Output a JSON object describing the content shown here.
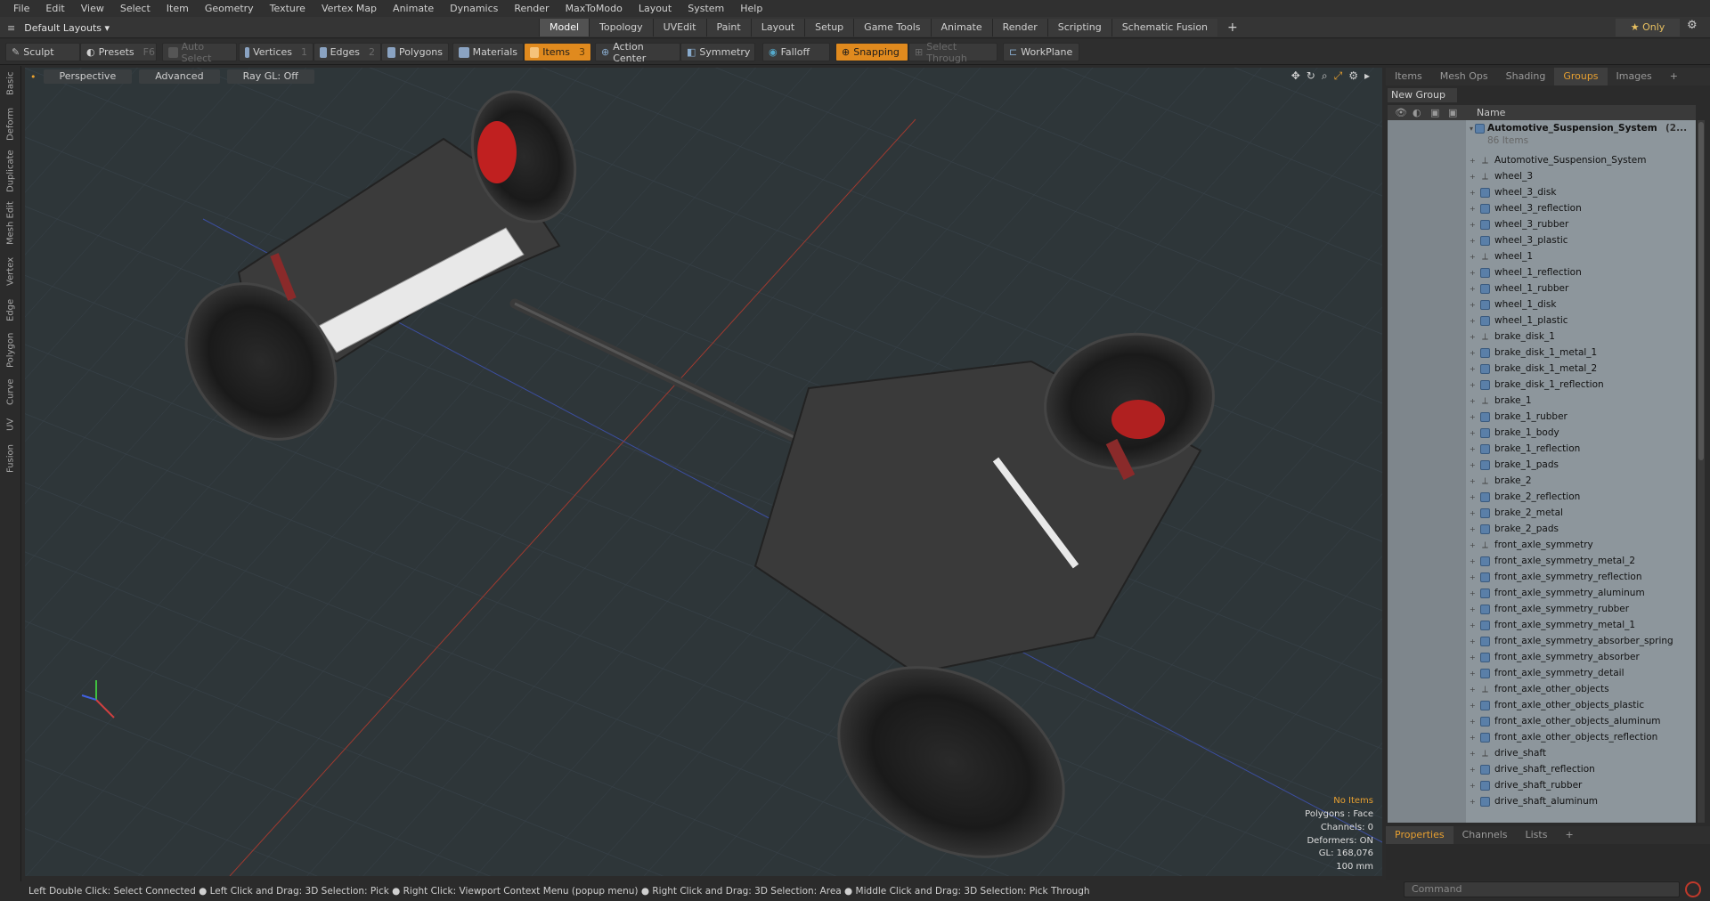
{
  "menubar": {
    "items": [
      "File",
      "Edit",
      "View",
      "Select",
      "Item",
      "Geometry",
      "Texture",
      "Vertex Map",
      "Animate",
      "Dynamics",
      "Render",
      "MaxToModo",
      "Layout",
      "System",
      "Help"
    ]
  },
  "layoutbar": {
    "layout_dropdown": "Default Layouts ▾",
    "tabs": [
      "Model",
      "Topology",
      "UVEdit",
      "Paint",
      "Layout",
      "Setup",
      "Game Tools",
      "Animate",
      "Render",
      "Scripting",
      "Schematic Fusion"
    ],
    "active_tab": "Model",
    "plus": "+",
    "only_button": "★ Only"
  },
  "toolbar": {
    "sculpt": "Sculpt",
    "presets": "Presets",
    "presets_key": "F6",
    "auto_select": "Auto Select",
    "vertices": "Vertices",
    "vertices_count": "1",
    "edges": "Edges",
    "edges_count": "2",
    "polygons": "Polygons",
    "materials": "Materials",
    "items": "Items",
    "items_count": "3",
    "action_center": "Action Center",
    "symmetry": "Symmetry",
    "falloff": "Falloff",
    "snapping": "Snapping",
    "select_through": "Select Through",
    "workplane": "WorkPlane"
  },
  "left_tabs": [
    "Basic",
    "Deform",
    "Duplicate",
    "Mesh Edit",
    "Vertex",
    "Edge",
    "Polygon",
    "Curve",
    "UV",
    "Fusion"
  ],
  "viewport": {
    "view_mode": "Perspective",
    "shading": "Advanced",
    "raygl": "Ray GL: Off",
    "info": {
      "selection": "No Items",
      "polygons": "Polygons : Face",
      "channels": "Channels: 0",
      "deformers": "Deformers: ON",
      "gl": "GL: 168,076",
      "scale": "100 mm"
    }
  },
  "right_panel": {
    "tabs": [
      "Items",
      "Mesh Ops",
      "Shading",
      "Groups",
      "Images"
    ],
    "active_tab": "Groups",
    "plus": "+",
    "new_group": "New Group",
    "column_name": "Name",
    "root": {
      "name": "Automotive_Suspension_System",
      "suffix": "(2...",
      "count": "86 Items"
    },
    "items": [
      {
        "name": "Automotive_Suspension_System",
        "kind": "locator"
      },
      {
        "name": "wheel_3",
        "kind": "locator"
      },
      {
        "name": "wheel_3_disk",
        "kind": "mesh"
      },
      {
        "name": "wheel_3_reflection",
        "kind": "mesh"
      },
      {
        "name": "wheel_3_rubber",
        "kind": "mesh"
      },
      {
        "name": "wheel_3_plastic",
        "kind": "mesh"
      },
      {
        "name": "wheel_1",
        "kind": "locator"
      },
      {
        "name": "wheel_1_reflection",
        "kind": "mesh"
      },
      {
        "name": "wheel_1_rubber",
        "kind": "mesh"
      },
      {
        "name": "wheel_1_disk",
        "kind": "mesh"
      },
      {
        "name": "wheel_1_plastic",
        "kind": "mesh"
      },
      {
        "name": "brake_disk_1",
        "kind": "locator"
      },
      {
        "name": "brake_disk_1_metal_1",
        "kind": "mesh"
      },
      {
        "name": "brake_disk_1_metal_2",
        "kind": "mesh"
      },
      {
        "name": "brake_disk_1_reflection",
        "kind": "mesh"
      },
      {
        "name": "brake_1",
        "kind": "locator"
      },
      {
        "name": "brake_1_rubber",
        "kind": "mesh"
      },
      {
        "name": "brake_1_body",
        "kind": "mesh"
      },
      {
        "name": "brake_1_reflection",
        "kind": "mesh"
      },
      {
        "name": "brake_1_pads",
        "kind": "mesh"
      },
      {
        "name": "brake_2",
        "kind": "locator"
      },
      {
        "name": "brake_2_reflection",
        "kind": "mesh"
      },
      {
        "name": "brake_2_metal",
        "kind": "mesh"
      },
      {
        "name": "brake_2_pads",
        "kind": "mesh"
      },
      {
        "name": "front_axle_symmetry",
        "kind": "locator"
      },
      {
        "name": "front_axle_symmetry_metal_2",
        "kind": "mesh"
      },
      {
        "name": "front_axle_symmetry_reflection",
        "kind": "mesh"
      },
      {
        "name": "front_axle_symmetry_aluminum",
        "kind": "mesh"
      },
      {
        "name": "front_axle_symmetry_rubber",
        "kind": "mesh"
      },
      {
        "name": "front_axle_symmetry_metal_1",
        "kind": "mesh"
      },
      {
        "name": "front_axle_symmetry_absorber_spring",
        "kind": "mesh"
      },
      {
        "name": "front_axle_symmetry_absorber",
        "kind": "mesh"
      },
      {
        "name": "front_axle_symmetry_detail",
        "kind": "mesh"
      },
      {
        "name": "front_axle_other_objects",
        "kind": "locator"
      },
      {
        "name": "front_axle_other_objects_plastic",
        "kind": "mesh"
      },
      {
        "name": "front_axle_other_objects_aluminum",
        "kind": "mesh"
      },
      {
        "name": "front_axle_other_objects_reflection",
        "kind": "mesh"
      },
      {
        "name": "drive_shaft",
        "kind": "locator"
      },
      {
        "name": "drive_shaft_reflection",
        "kind": "mesh"
      },
      {
        "name": "drive_shaft_rubber",
        "kind": "mesh"
      },
      {
        "name": "drive_shaft_aluminum",
        "kind": "mesh"
      }
    ]
  },
  "bottom_panel": {
    "tabs": [
      "Properties",
      "Channels",
      "Lists"
    ],
    "active_tab": "Properties",
    "plus": "+"
  },
  "command": {
    "placeholder": "Command"
  },
  "status_bar": "Left Double Click: Select Connected ● Left Click and Drag: 3D Selection: Pick ● Right Click: Viewport Context Menu (popup menu) ● Right Click and Drag: 3D Selection: Area ● Middle Click and Drag: 3D Selection: Pick Through",
  "colors": {
    "accent": "#e08a1e",
    "active_text": "#e8a030",
    "viewport_bg": "#2e3639",
    "list_bg": "#8d969c"
  }
}
